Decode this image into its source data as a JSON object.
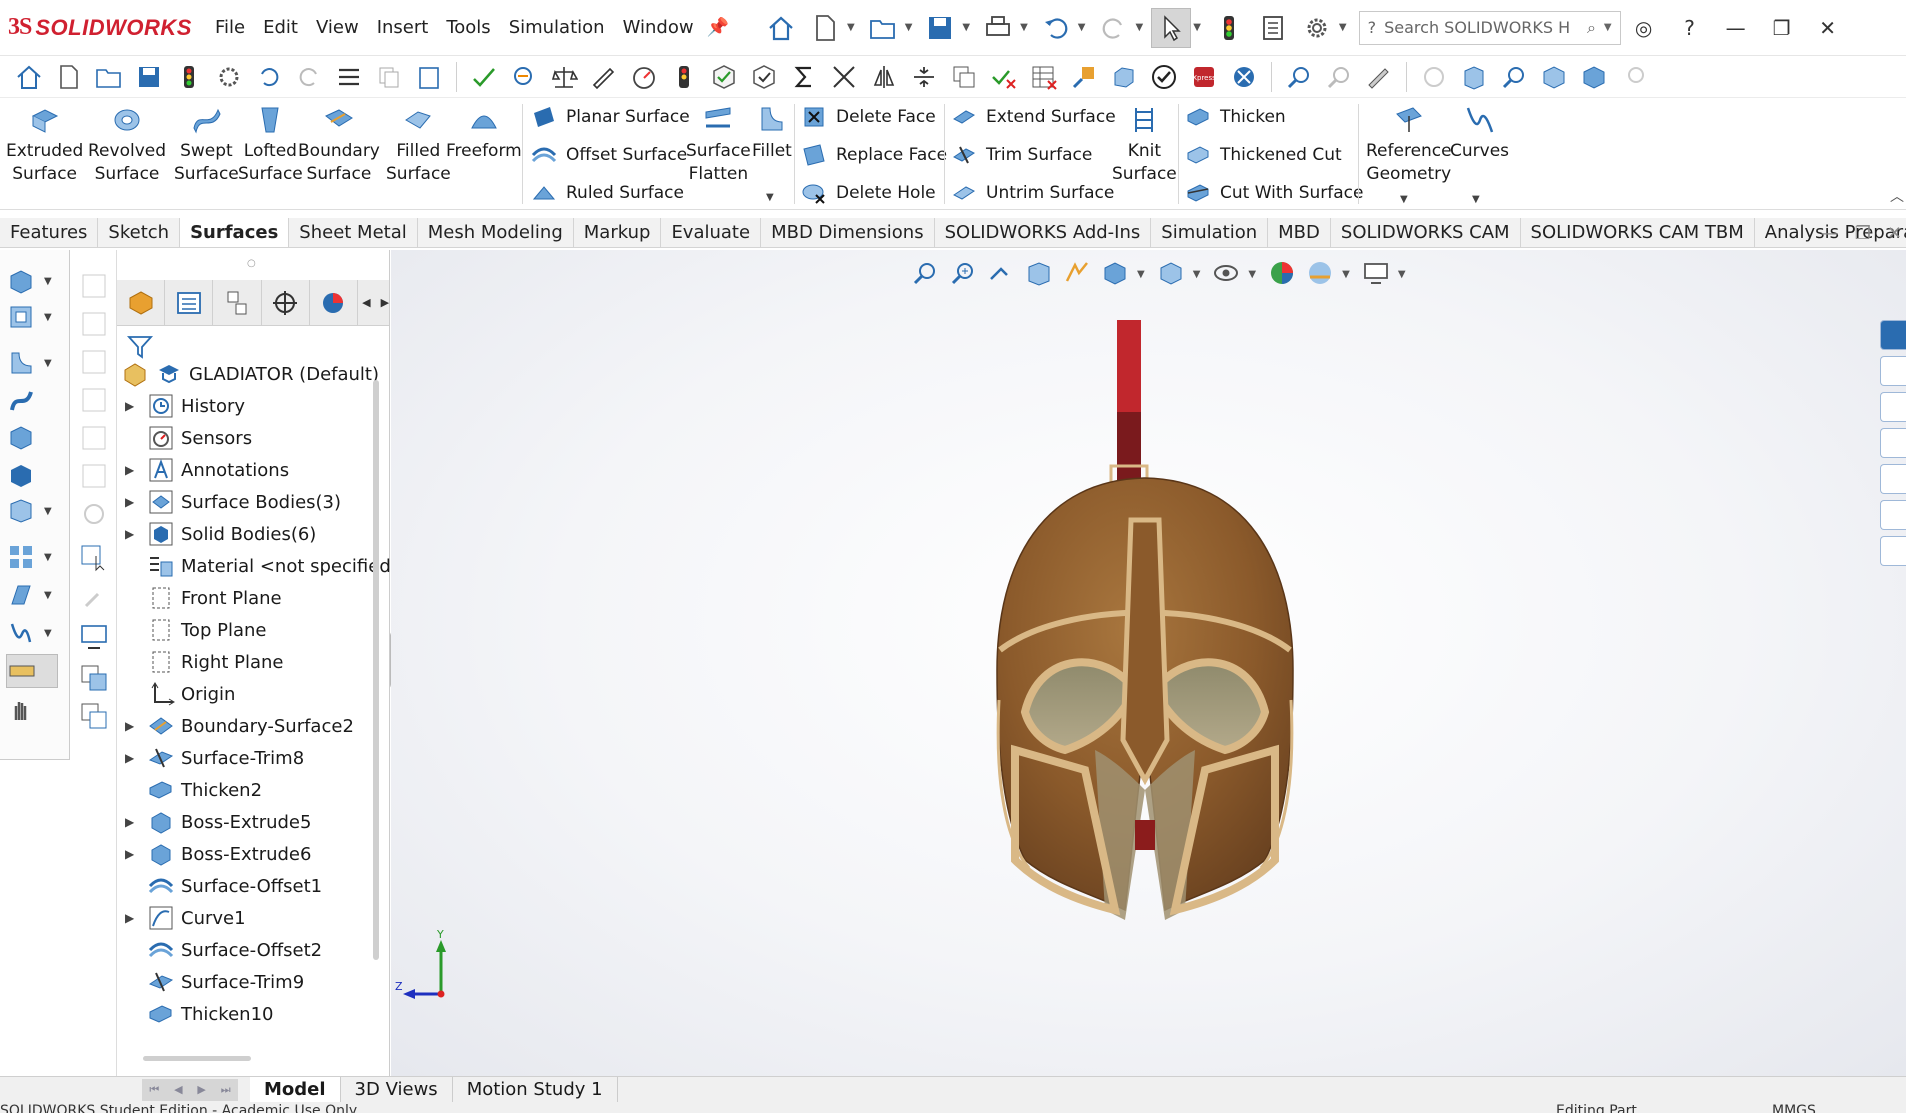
{
  "app": {
    "brand_prefix": "3S",
    "brand_name": "SOLIDWORKS",
    "menu": [
      "File",
      "Edit",
      "View",
      "Insert",
      "Tools",
      "Simulation",
      "Window"
    ],
    "search_placeholder": "Search SOLIDWORKS H",
    "accent_color": "#d02030"
  },
  "command_manager": {
    "large_buttons": [
      {
        "label_1": "Extruded",
        "label_2": "Surface",
        "icon": "extruded-surface-icon"
      },
      {
        "label_1": "Revolved",
        "label_2": "Surface",
        "icon": "revolved-surface-icon"
      },
      {
        "label_1": "Swept",
        "label_2": "Surface",
        "icon": "swept-surface-icon"
      },
      {
        "label_1": "Lofted",
        "label_2": "Surface",
        "icon": "lofted-surface-icon"
      },
      {
        "label_1": "Boundary",
        "label_2": "Surface",
        "icon": "boundary-surface-icon"
      },
      {
        "label_1": "Filled",
        "label_2": "Surface",
        "icon": "filled-surface-icon"
      },
      {
        "label_1": "Freeform",
        "label_2": "",
        "icon": "freeform-icon"
      }
    ],
    "group1": [
      "Planar Surface",
      "Offset Surface",
      "Ruled Surface"
    ],
    "surface_flatten": {
      "label_1": "Surface",
      "label_2": "Flatten"
    },
    "fillet": "Fillet",
    "group2": [
      "Delete Face",
      "Replace Face",
      "Delete Hole"
    ],
    "group3": [
      "Extend Surface",
      "Trim Surface",
      "Untrim Surface"
    ],
    "knit_surface": {
      "label_1": "Knit",
      "label_2": "Surface"
    },
    "group4": [
      "Thicken",
      "Thickened Cut",
      "Cut With Surface"
    ],
    "reference_geometry": {
      "label_1": "Reference",
      "label_2": "Geometry"
    },
    "curves": "Curves"
  },
  "tabs": {
    "items": [
      "Features",
      "Sketch",
      "Surfaces",
      "Sheet Metal",
      "Mesh Modeling",
      "Markup",
      "Evaluate",
      "MBD Dimensions",
      "SOLIDWORKS Add-Ins",
      "Simulation",
      "MBD",
      "SOLIDWORKS CAM",
      "SOLIDWORKS CAM TBM",
      "Analysis Preparation"
    ],
    "active": "Surfaces"
  },
  "feature_tree": {
    "root": "GLADIATOR (Default)",
    "nodes": [
      {
        "label": "History",
        "expandable": true
      },
      {
        "label": "Sensors",
        "expandable": false
      },
      {
        "label": "Annotations",
        "expandable": true
      },
      {
        "label": "Surface Bodies(3)",
        "expandable": true
      },
      {
        "label": "Solid Bodies(6)",
        "expandable": true
      },
      {
        "label": "Material <not specified>",
        "expandable": false
      },
      {
        "label": "Front Plane",
        "expandable": false
      },
      {
        "label": "Top Plane",
        "expandable": false
      },
      {
        "label": "Right Plane",
        "expandable": false
      },
      {
        "label": "Origin",
        "expandable": false
      },
      {
        "label": "Boundary-Surface2",
        "expandable": true
      },
      {
        "label": "Surface-Trim8",
        "expandable": true
      },
      {
        "label": "Thicken2",
        "expandable": false
      },
      {
        "label": "Boss-Extrude5",
        "expandable": true
      },
      {
        "label": "Boss-Extrude6",
        "expandable": true
      },
      {
        "label": "Surface-Offset1",
        "expandable": false
      },
      {
        "label": "Curve1",
        "expandable": true
      },
      {
        "label": "Surface-Offset2",
        "expandable": false
      },
      {
        "label": "Surface-Trim9",
        "expandable": false
      },
      {
        "label": "Thicken10",
        "expandable": false
      }
    ]
  },
  "viewport": {
    "triad_y": "Y",
    "triad_z": "Z",
    "helmet_colors": {
      "bronze": "#8b5a2b",
      "trim": "#d9b886",
      "crest": "#c1272d",
      "visor": "#a09070"
    }
  },
  "bottom_tabs": {
    "items": [
      "Model",
      "3D Views",
      "Motion Study 1"
    ],
    "active": "Model"
  },
  "status_bar": {
    "left": "SOLIDWORKS Student Edition - Academic Use Only",
    "middle": "Editing Part",
    "right": "MMGS"
  }
}
